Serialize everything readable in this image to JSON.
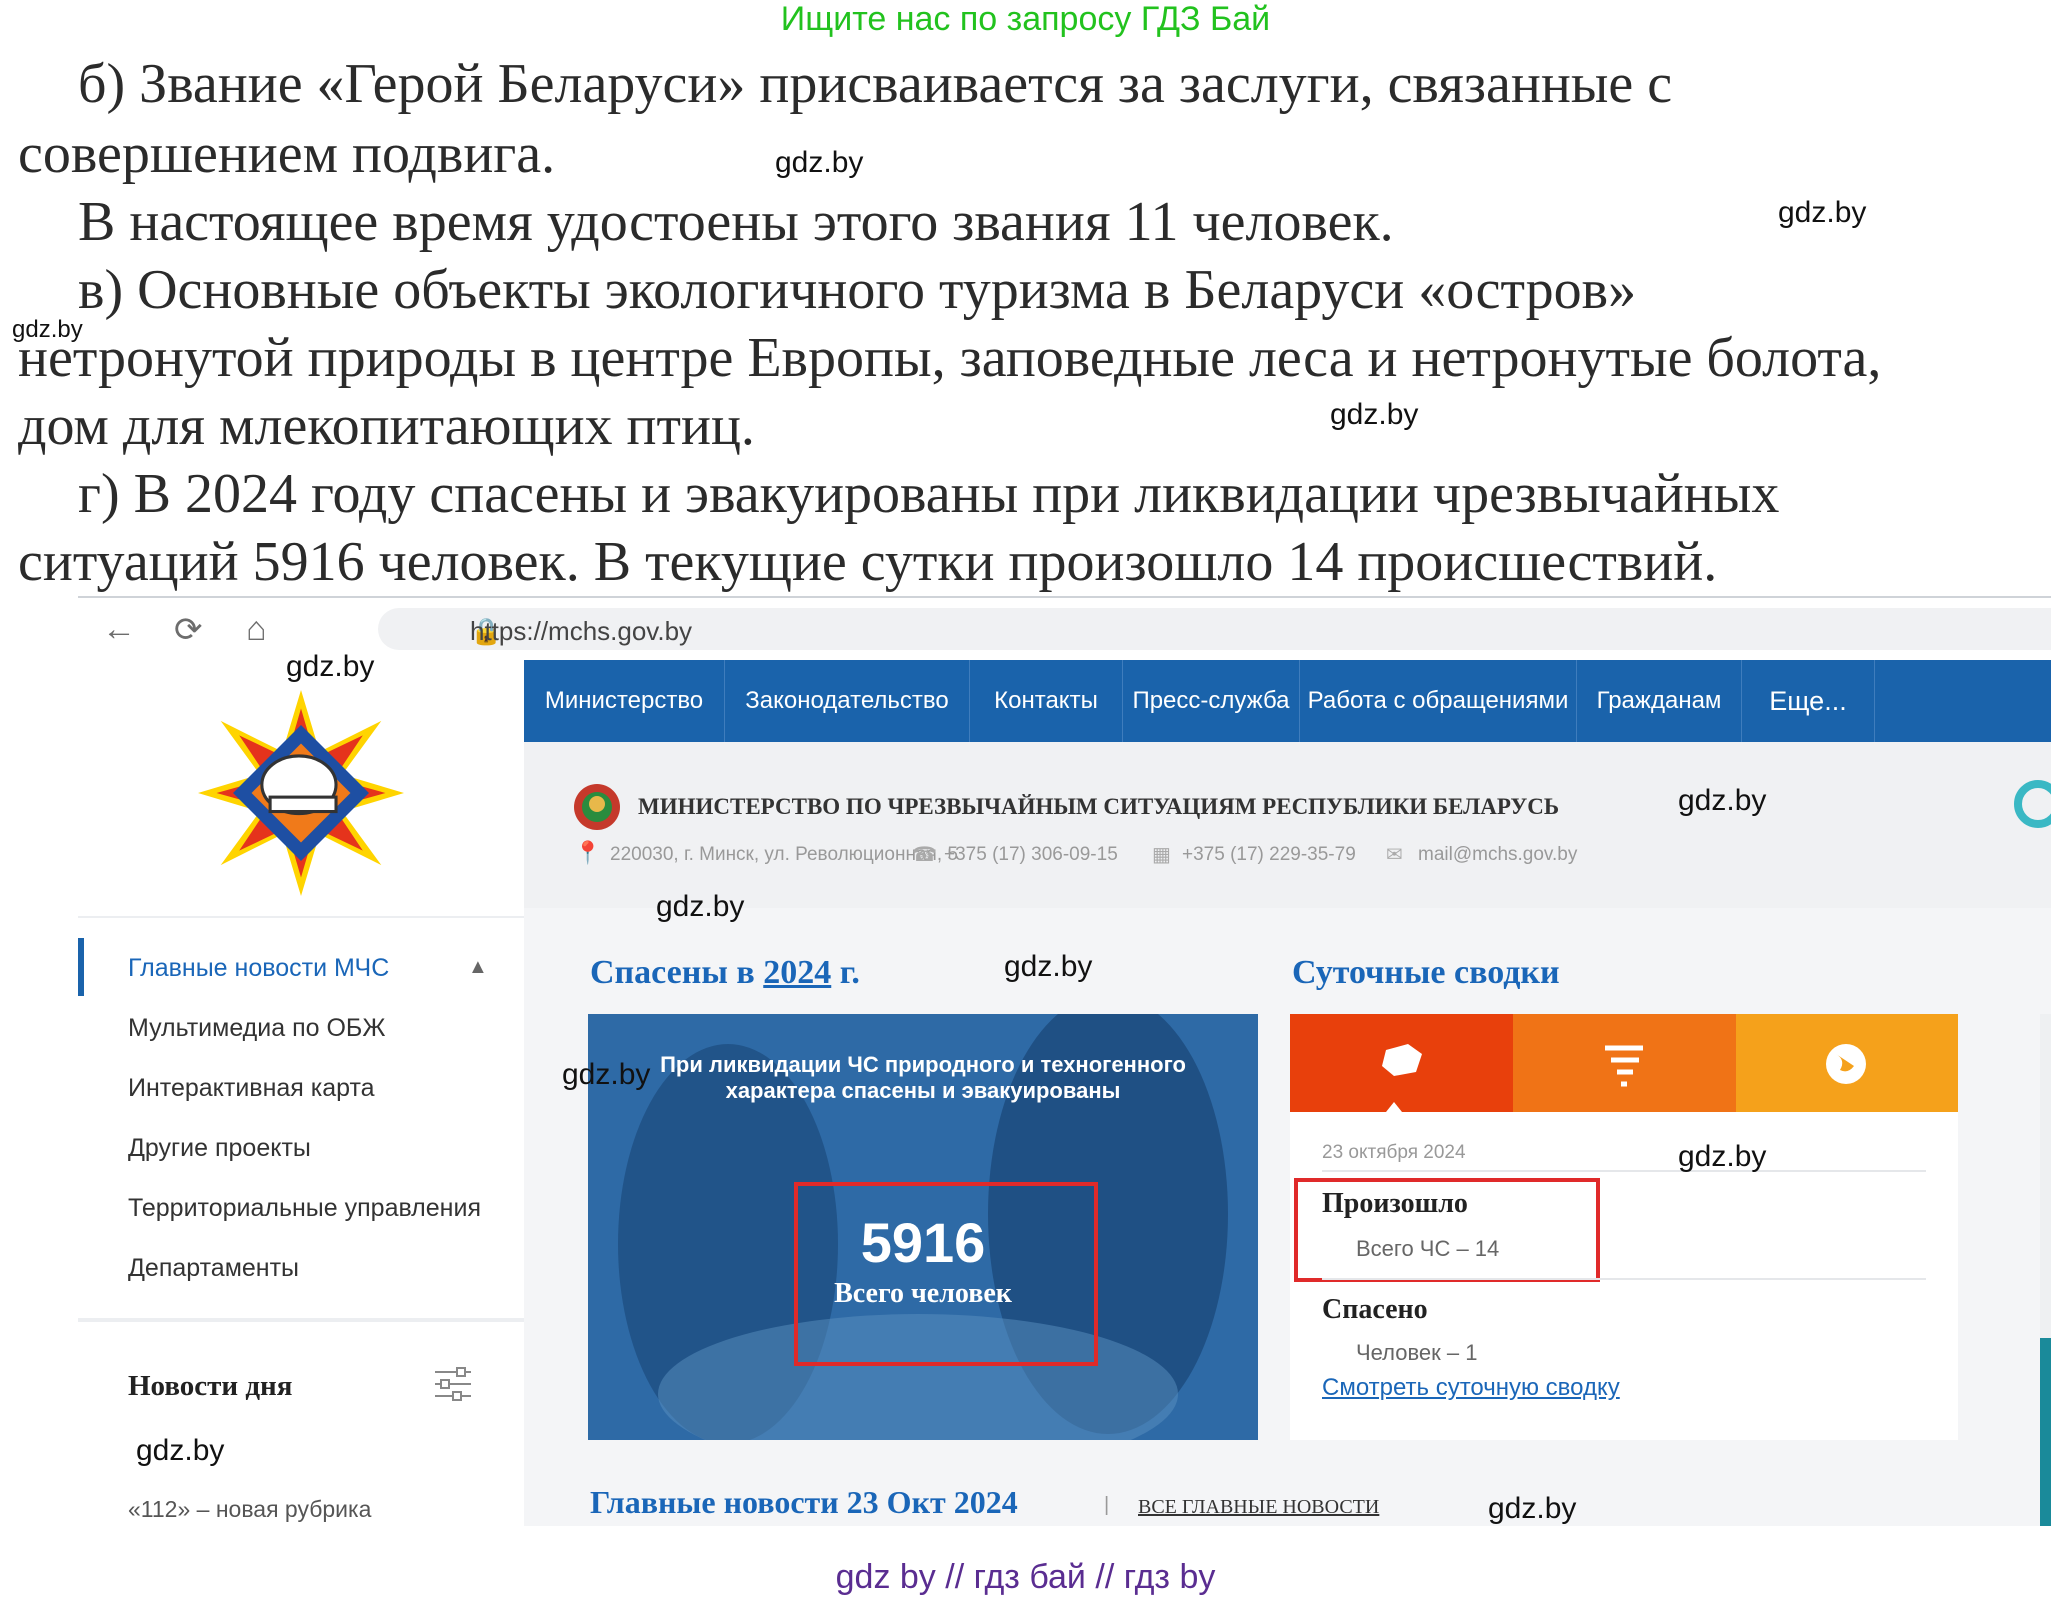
{
  "top_banner": "Ищите нас по запросу ГДЗ Бай",
  "paragraphs": {
    "b_line1": "б) Звание «Герой Беларуси» присваивается за заслуги, связанные с",
    "b_line2": "совершением подвига.",
    "b2": "В настоящее время удостоены этого звания 11 человек.",
    "v_line1": "в) Основные объекты экологичного туризма в Беларуси «остров»",
    "v_line2": "нетронутой природы в центре Европы, заповедные леса и нетронутые болота,",
    "v_line3": "дом для млекопитающих птиц.",
    "g_line1": "г) В 2024 году спасены и эвакуированы при ликвидации чрезвычайных",
    "g_line2": "ситуаций 5916 человек. В текущие сутки произошло 14 происшествий."
  },
  "watermark": "gdz.by",
  "bottom_watermark": "gdz by  //  гдз бай  //  гдз by",
  "browser": {
    "url": "https://mchs.gov.by"
  },
  "nav": [
    "Министерство",
    "Законодательство",
    "Контакты",
    "Пресс-служба",
    "Работа с обращениями",
    "Гражданам",
    "Еще..."
  ],
  "header": {
    "org_name": "МИНИСТЕРСТВО ПО ЧРЕЗВЫЧАЙНЫМ СИТУАЦИЯМ РЕСПУБЛИКИ БЕЛАРУСЬ",
    "address": "220030, г. Минск, ул. Революционная, 5",
    "phone": "+375 (17) 306-09-15",
    "fax": "+375 (17) 229-35-79",
    "email": "mail@mchs.gov.by"
  },
  "sidebar": {
    "items": [
      "Главные новости МЧС",
      "Мультимедиа по ОБЖ",
      "Интерактивная карта",
      "Другие проекты",
      "Территориальные управления",
      "Департаменты"
    ],
    "news_day_title": "Новости дня",
    "news_snippet": "«112» – новая рубрика"
  },
  "saved": {
    "title_prefix": "Спасены в ",
    "year": "2024",
    "title_suffix": " г.",
    "caption_line1": "При ликвидации ЧС природного и техногенного",
    "caption_line2": "характера спасены и эвакуированы",
    "count": "5916",
    "count_label": "Всего человек"
  },
  "daily": {
    "title": "Суточные сводки",
    "date": "23 октября 2024",
    "happened_label": "Произошло",
    "happened_value": "Всего ЧС – 14",
    "rescued_label": "Спасено",
    "rescued_value": "Человек – 1",
    "link": "Смотреть суточную сводку",
    "tab_colors": [
      "#e8400c",
      "#f07316",
      "#f5a11b"
    ]
  },
  "main_news": {
    "title": "Главные новости 23 Окт 2024",
    "all_link": "ВСЕ ГЛАВНЫЕ НОВОСТИ"
  }
}
